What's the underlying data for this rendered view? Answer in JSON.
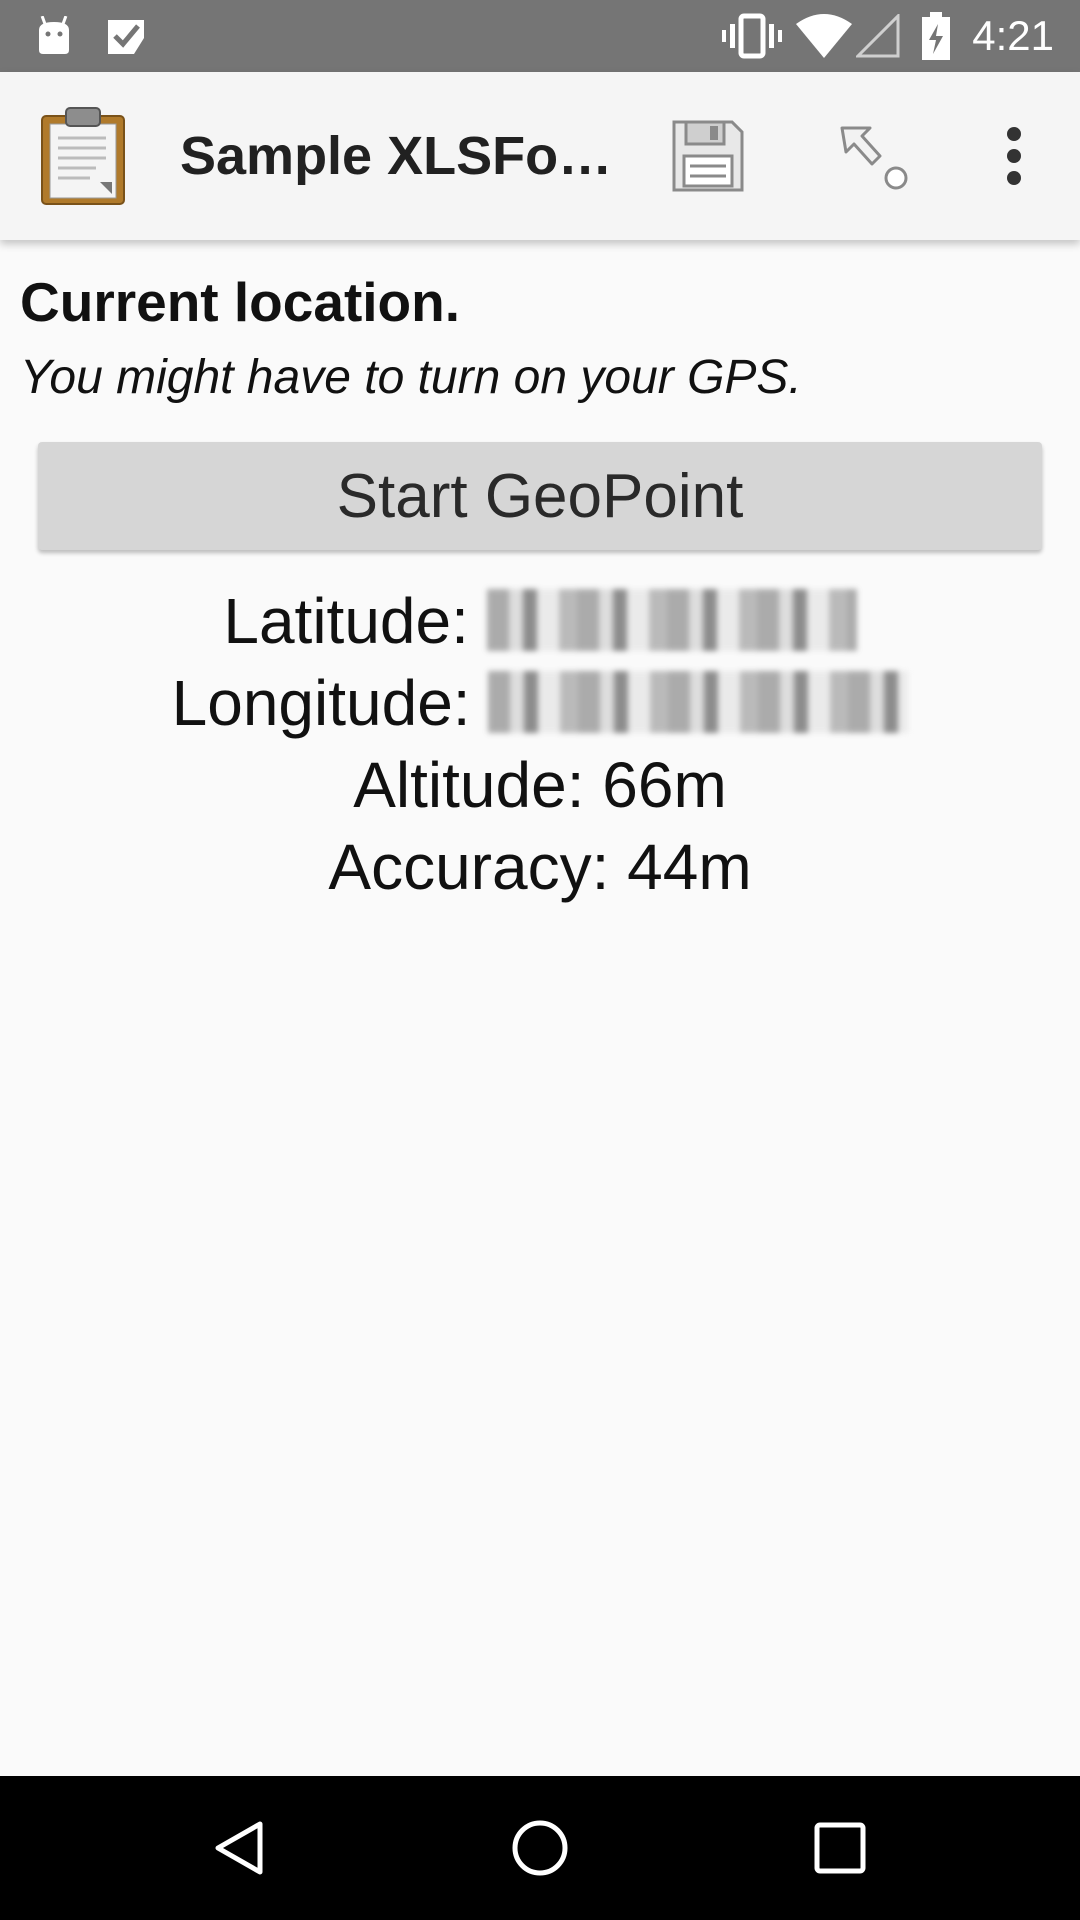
{
  "status_bar": {
    "time": "4:21",
    "background": "#757575",
    "icons": [
      "android-notification-icon",
      "task-done-icon",
      "vibrate-icon",
      "wifi-icon",
      "cell-signal-icon",
      "battery-charging-icon"
    ]
  },
  "app_bar": {
    "title": "Sample XLSFo…",
    "logo": "clipboard-icon",
    "actions": [
      "save-icon",
      "jump-icon",
      "overflow-menu-icon"
    ]
  },
  "question": {
    "label": "Current location.",
    "hint": "You might have to turn on your GPS."
  },
  "geo_button": {
    "label": "Start GeoPoint"
  },
  "geo_info": {
    "latitude_label": "Latitude:",
    "longitude_label": "Longitude:",
    "altitude": "Altitude: 66m",
    "accuracy": "Accuracy: 44m"
  },
  "nav_bar": {
    "buttons": [
      "back-icon",
      "home-icon",
      "recents-icon"
    ]
  }
}
